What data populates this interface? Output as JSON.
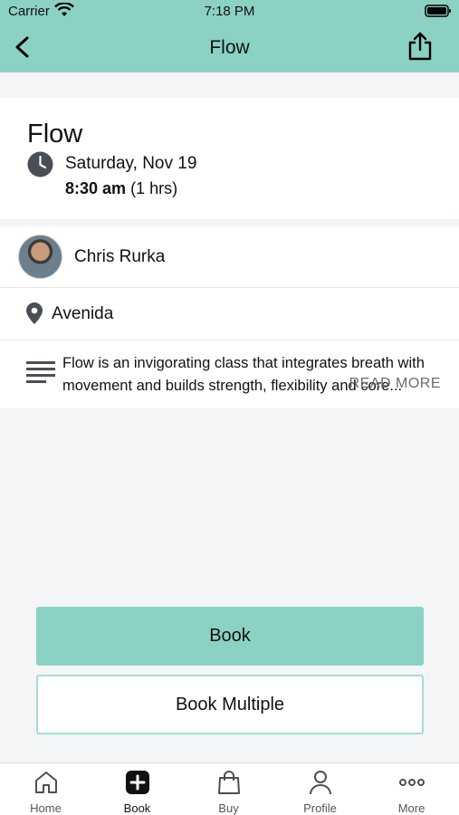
{
  "status_bar": {
    "carrier": "Carrier",
    "time": "7:18 PM"
  },
  "nav": {
    "title": "Flow"
  },
  "class_info": {
    "title": "Flow",
    "date": "Saturday, Nov 19",
    "time_bold": "8:30 am",
    "duration": "(1 hrs)"
  },
  "instructor": {
    "name": "Chris Rurka"
  },
  "location": {
    "name": "Avenida"
  },
  "description": {
    "text": "Flow is an invigorating class that integrates breath with movement and builds strength, flexibility and core...",
    "read_more": "READ MORE"
  },
  "actions": {
    "book": "Book",
    "book_multiple": "Book Multiple"
  },
  "tabs": [
    {
      "label": "Home",
      "icon": "home-icon"
    },
    {
      "label": "Book",
      "icon": "plus-square-icon"
    },
    {
      "label": "Buy",
      "icon": "shopping-bag-icon"
    },
    {
      "label": "Profile",
      "icon": "person-icon"
    },
    {
      "label": "More",
      "icon": "more-dots-icon"
    }
  ],
  "colors": {
    "accent": "#8bd1c4",
    "background": "#f3f5f7",
    "icon_dark": "#4a4f55"
  }
}
